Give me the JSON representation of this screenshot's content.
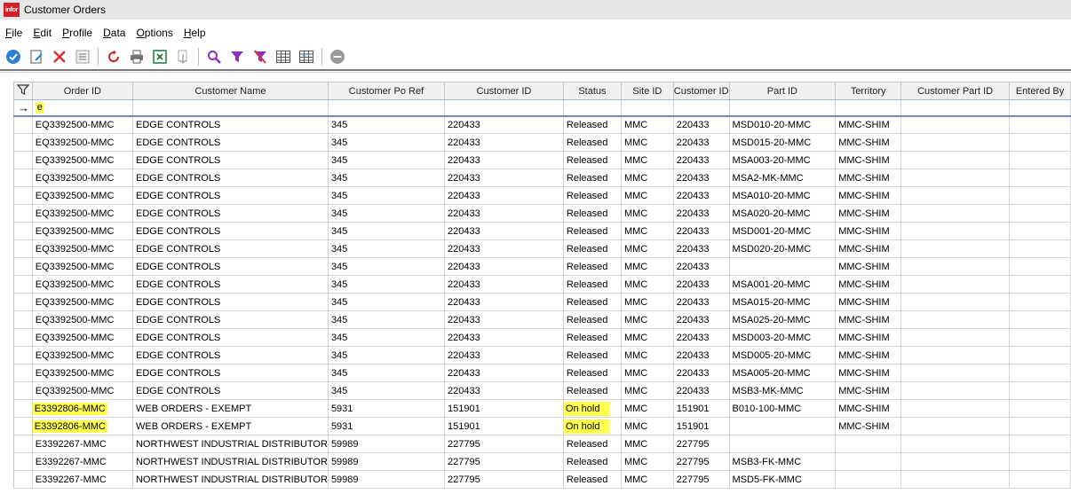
{
  "window": {
    "title": "Customer Orders",
    "logo_text": "infor"
  },
  "menu": [
    {
      "first": "F",
      "rest": "ile"
    },
    {
      "first": "E",
      "rest": "dit"
    },
    {
      "first": "P",
      "rest": "rofile"
    },
    {
      "first": "D",
      "rest": "ata"
    },
    {
      "first": "O",
      "rest": "ptions"
    },
    {
      "first": "H",
      "rest": "elp"
    }
  ],
  "toolbar": {
    "icons": [
      "checkmark-icon",
      "edit-document-icon",
      "delete-icon",
      "list-icon",
      "refresh-icon",
      "print-icon",
      "excel-export-icon",
      "import-icon",
      "search-icon",
      "filter-icon",
      "clear-filter-icon",
      "grid-icon",
      "grid-layout-icon",
      "stop-icon"
    ],
    "colors": {
      "check": "#2d7fd3",
      "delete": "#e03030",
      "refresh": "#cc2222",
      "filter": "#8a2fc2",
      "excel": "#1e7c3a"
    }
  },
  "columns": [
    "Order ID",
    "Customer Name",
    "Customer Po Ref",
    "Customer ID",
    "Status",
    "Site ID",
    "Customer ID",
    "Part ID",
    "Territory",
    "Customer Part ID",
    "Entered By"
  ],
  "filter": {
    "value": "e"
  },
  "rows": [
    {
      "order_id": "EQ3392500-MMC",
      "customer_name": "EDGE CONTROLS",
      "po_ref": "345",
      "customer_id": "220433",
      "status": "Released",
      "site_id": "MMC",
      "customer_id2": "220433",
      "part_id": "MSD010-20-MMC",
      "territory": "MMC-SHIM",
      "customer_part_id": "",
      "entered_by": "",
      "highlight": false
    },
    {
      "order_id": "EQ3392500-MMC",
      "customer_name": "EDGE CONTROLS",
      "po_ref": "345",
      "customer_id": "220433",
      "status": "Released",
      "site_id": "MMC",
      "customer_id2": "220433",
      "part_id": "MSD015-20-MMC",
      "territory": "MMC-SHIM",
      "customer_part_id": "",
      "entered_by": "",
      "highlight": false
    },
    {
      "order_id": "EQ3392500-MMC",
      "customer_name": "EDGE CONTROLS",
      "po_ref": "345",
      "customer_id": "220433",
      "status": "Released",
      "site_id": "MMC",
      "customer_id2": "220433",
      "part_id": "MSA003-20-MMC",
      "territory": "MMC-SHIM",
      "customer_part_id": "",
      "entered_by": "",
      "highlight": false
    },
    {
      "order_id": "EQ3392500-MMC",
      "customer_name": "EDGE CONTROLS",
      "po_ref": "345",
      "customer_id": "220433",
      "status": "Released",
      "site_id": "MMC",
      "customer_id2": "220433",
      "part_id": "MSA2-MK-MMC",
      "territory": "MMC-SHIM",
      "customer_part_id": "",
      "entered_by": "",
      "highlight": false
    },
    {
      "order_id": "EQ3392500-MMC",
      "customer_name": "EDGE CONTROLS",
      "po_ref": "345",
      "customer_id": "220433",
      "status": "Released",
      "site_id": "MMC",
      "customer_id2": "220433",
      "part_id": "MSA010-20-MMC",
      "territory": "MMC-SHIM",
      "customer_part_id": "",
      "entered_by": "",
      "highlight": false
    },
    {
      "order_id": "EQ3392500-MMC",
      "customer_name": "EDGE CONTROLS",
      "po_ref": "345",
      "customer_id": "220433",
      "status": "Released",
      "site_id": "MMC",
      "customer_id2": "220433",
      "part_id": "MSA020-20-MMC",
      "territory": "MMC-SHIM",
      "customer_part_id": "",
      "entered_by": "",
      "highlight": false
    },
    {
      "order_id": "EQ3392500-MMC",
      "customer_name": "EDGE CONTROLS",
      "po_ref": "345",
      "customer_id": "220433",
      "status": "Released",
      "site_id": "MMC",
      "customer_id2": "220433",
      "part_id": "MSD001-20-MMC",
      "territory": "MMC-SHIM",
      "customer_part_id": "",
      "entered_by": "",
      "highlight": false
    },
    {
      "order_id": "EQ3392500-MMC",
      "customer_name": "EDGE CONTROLS",
      "po_ref": "345",
      "customer_id": "220433",
      "status": "Released",
      "site_id": "MMC",
      "customer_id2": "220433",
      "part_id": "MSD020-20-MMC",
      "territory": "MMC-SHIM",
      "customer_part_id": "",
      "entered_by": "",
      "highlight": false
    },
    {
      "order_id": "EQ3392500-MMC",
      "customer_name": "EDGE CONTROLS",
      "po_ref": "345",
      "customer_id": "220433",
      "status": "Released",
      "site_id": "MMC",
      "customer_id2": "220433",
      "part_id": "",
      "territory": "MMC-SHIM",
      "customer_part_id": "",
      "entered_by": "",
      "highlight": false
    },
    {
      "order_id": "EQ3392500-MMC",
      "customer_name": "EDGE CONTROLS",
      "po_ref": "345",
      "customer_id": "220433",
      "status": "Released",
      "site_id": "MMC",
      "customer_id2": "220433",
      "part_id": "MSA001-20-MMC",
      "territory": "MMC-SHIM",
      "customer_part_id": "",
      "entered_by": "",
      "highlight": false
    },
    {
      "order_id": "EQ3392500-MMC",
      "customer_name": "EDGE CONTROLS",
      "po_ref": "345",
      "customer_id": "220433",
      "status": "Released",
      "site_id": "MMC",
      "customer_id2": "220433",
      "part_id": "MSA015-20-MMC",
      "territory": "MMC-SHIM",
      "customer_part_id": "",
      "entered_by": "",
      "highlight": false
    },
    {
      "order_id": "EQ3392500-MMC",
      "customer_name": "EDGE CONTROLS",
      "po_ref": "345",
      "customer_id": "220433",
      "status": "Released",
      "site_id": "MMC",
      "customer_id2": "220433",
      "part_id": "MSA025-20-MMC",
      "territory": "MMC-SHIM",
      "customer_part_id": "",
      "entered_by": "",
      "highlight": false
    },
    {
      "order_id": "EQ3392500-MMC",
      "customer_name": "EDGE CONTROLS",
      "po_ref": "345",
      "customer_id": "220433",
      "status": "Released",
      "site_id": "MMC",
      "customer_id2": "220433",
      "part_id": "MSD003-20-MMC",
      "territory": "MMC-SHIM",
      "customer_part_id": "",
      "entered_by": "",
      "highlight": false
    },
    {
      "order_id": "EQ3392500-MMC",
      "customer_name": "EDGE CONTROLS",
      "po_ref": "345",
      "customer_id": "220433",
      "status": "Released",
      "site_id": "MMC",
      "customer_id2": "220433",
      "part_id": "MSD005-20-MMC",
      "territory": "MMC-SHIM",
      "customer_part_id": "",
      "entered_by": "",
      "highlight": false
    },
    {
      "order_id": "EQ3392500-MMC",
      "customer_name": "EDGE CONTROLS",
      "po_ref": "345",
      "customer_id": "220433",
      "status": "Released",
      "site_id": "MMC",
      "customer_id2": "220433",
      "part_id": "MSA005-20-MMC",
      "territory": "MMC-SHIM",
      "customer_part_id": "",
      "entered_by": "",
      "highlight": false
    },
    {
      "order_id": "EQ3392500-MMC",
      "customer_name": "EDGE CONTROLS",
      "po_ref": "345",
      "customer_id": "220433",
      "status": "Released",
      "site_id": "MMC",
      "customer_id2": "220433",
      "part_id": "MSB3-MK-MMC",
      "territory": "MMC-SHIM",
      "customer_part_id": "",
      "entered_by": "",
      "highlight": false
    },
    {
      "order_id": "E3392806-MMC",
      "customer_name": "WEB ORDERS - EXEMPT",
      "po_ref": "5931",
      "customer_id": "151901",
      "status": "On hold",
      "site_id": "MMC",
      "customer_id2": "151901",
      "part_id": "B010-100-MMC",
      "territory": "MMC-SHIM",
      "customer_part_id": "",
      "entered_by": "",
      "highlight": true
    },
    {
      "order_id": "E3392806-MMC",
      "customer_name": "WEB ORDERS - EXEMPT",
      "po_ref": "5931",
      "customer_id": "151901",
      "status": "On hold",
      "site_id": "MMC",
      "customer_id2": "151901",
      "part_id": "",
      "territory": "MMC-SHIM",
      "customer_part_id": "",
      "entered_by": "",
      "highlight": true
    },
    {
      "order_id": "E3392267-MMC",
      "customer_name": "NORTHWEST INDUSTRIAL DISTRIBUTOR",
      "po_ref": "59989",
      "customer_id": "227795",
      "status": "Released",
      "site_id": "MMC",
      "customer_id2": "227795",
      "part_id": "",
      "territory": "",
      "customer_part_id": "",
      "entered_by": "",
      "highlight": false
    },
    {
      "order_id": "E3392267-MMC",
      "customer_name": "NORTHWEST INDUSTRIAL DISTRIBUTOR",
      "po_ref": "59989",
      "customer_id": "227795",
      "status": "Released",
      "site_id": "MMC",
      "customer_id2": "227795",
      "part_id": "MSB3-FK-MMC",
      "territory": "",
      "customer_part_id": "",
      "entered_by": "",
      "highlight": false
    },
    {
      "order_id": "E3392267-MMC",
      "customer_name": "NORTHWEST INDUSTRIAL DISTRIBUTOR",
      "po_ref": "59989",
      "customer_id": "227795",
      "status": "Released",
      "site_id": "MMC",
      "customer_id2": "227795",
      "part_id": "MSD5-FK-MMC",
      "territory": "",
      "customer_part_id": "",
      "entered_by": "",
      "highlight": false
    }
  ]
}
